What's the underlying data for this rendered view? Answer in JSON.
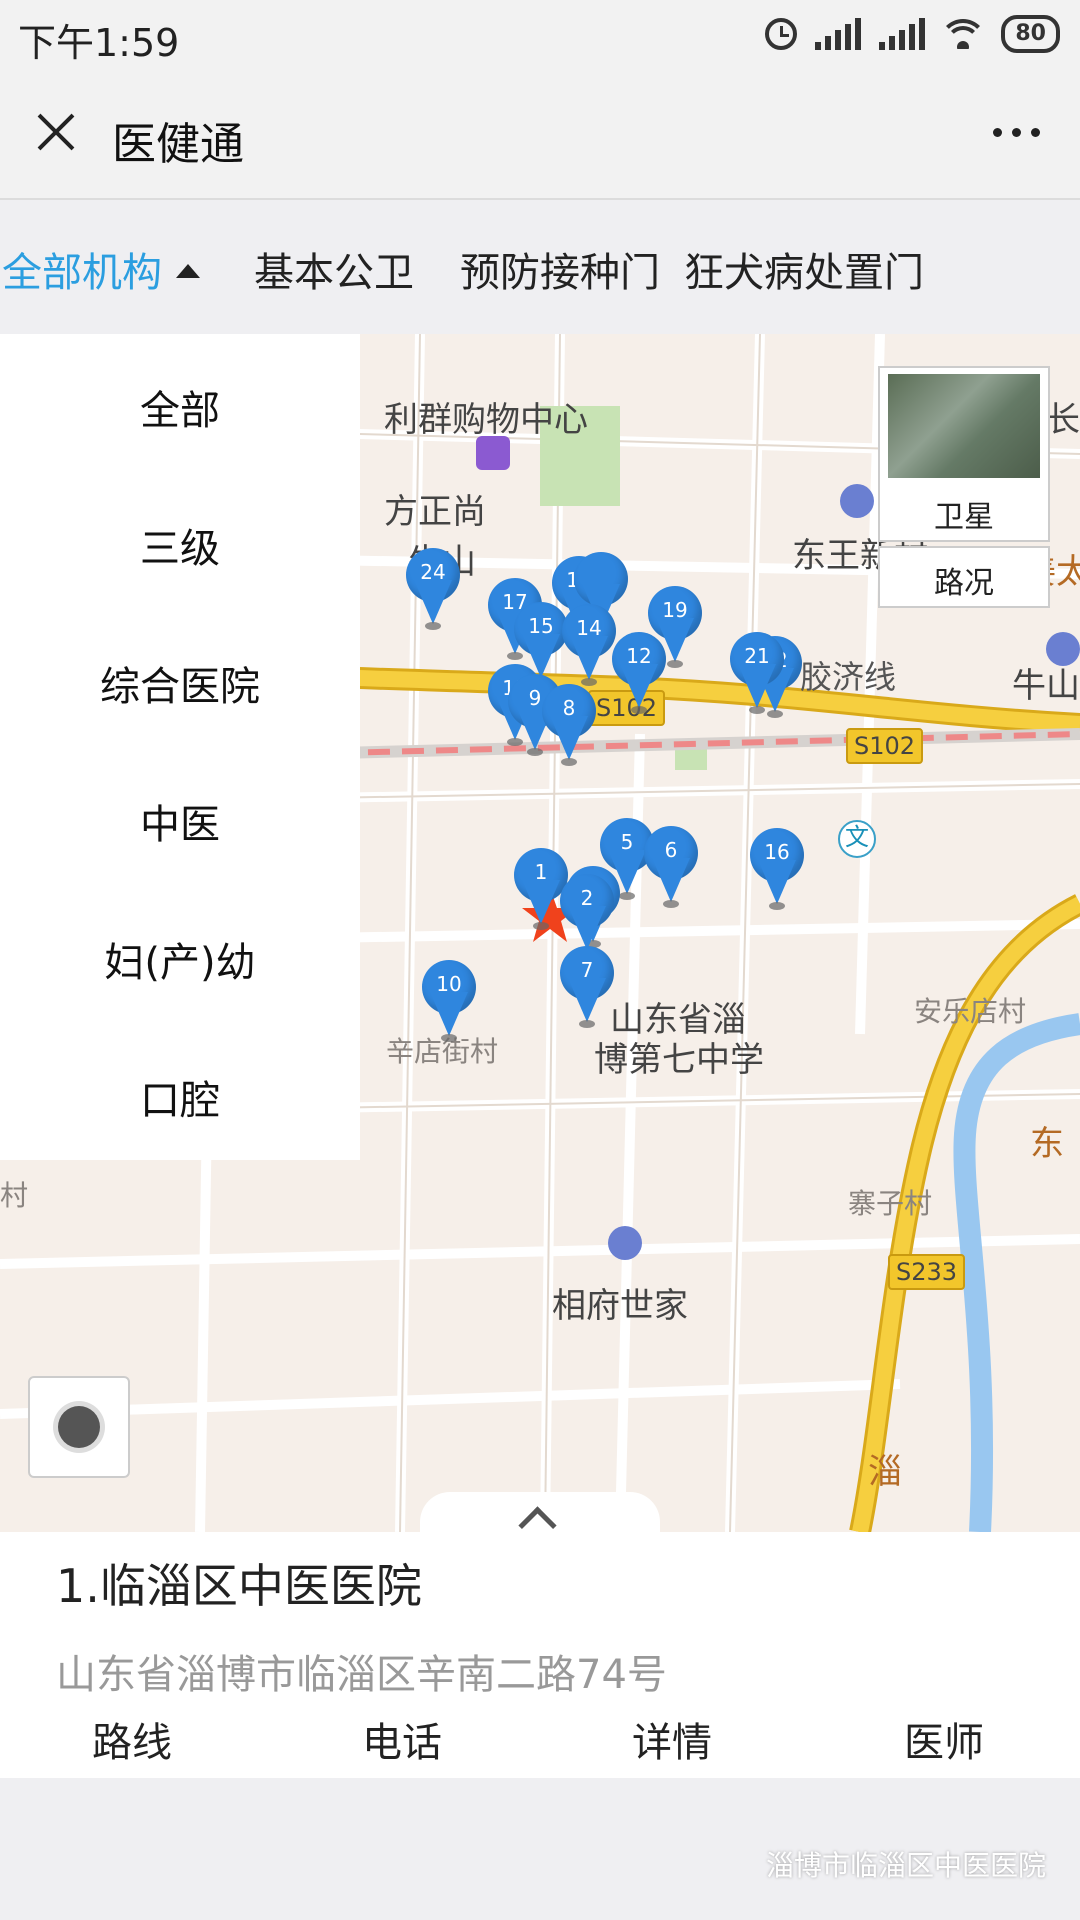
{
  "status": {
    "time": "下午1:59",
    "battery": "80"
  },
  "header": {
    "title": "医健通"
  },
  "tabs": [
    {
      "label": "全部机构",
      "active": true
    },
    {
      "label": "基本公卫"
    },
    {
      "label": "预防接种门"
    },
    {
      "label": "狂犬病处置门"
    }
  ],
  "dropdown": {
    "items": [
      "全部",
      "三级",
      "综合医院",
      "中医",
      "妇(产)幼",
      "口腔"
    ]
  },
  "map": {
    "controls": {
      "satellite": "卫星",
      "traffic": "路况"
    },
    "labels": {
      "liqun": "利群购物中心",
      "fangzheng": "方正尚",
      "niushan": "牛山",
      "dongwang": "东王新村",
      "jiangtai": "姜太",
      "changjia": "长家",
      "jiaoji": "胶济线",
      "niushan2": "牛山",
      "school": "山东省淄\n博第七中学",
      "school_line1": "山东省淄",
      "school_line2": "博第七中学",
      "anle": "安乐店村",
      "xindian": "辛店街村",
      "zhaizi": "寨子村",
      "xiangfu": "相府世家",
      "left_edge": "村",
      "dong": "东",
      "zi": "淄"
    },
    "roads": [
      "S102",
      "S102",
      "S233"
    ],
    "markers": [
      "1",
      "2",
      "5",
      "6",
      "7",
      "8",
      "9",
      "10",
      "11",
      "12",
      "14",
      "15",
      "16",
      "17",
      "18",
      "19",
      "21",
      "22",
      "24"
    ]
  },
  "selected": {
    "name": "1.临淄区中医医院",
    "address": "山东省淄博市临淄区辛南二路74号"
  },
  "actions": [
    "路线",
    "电话",
    "详情",
    "医师"
  ],
  "footer": {
    "watermark": "淄博市临淄区中医医院"
  },
  "colors": {
    "accent": "#2b9ee0",
    "marker": "#2f86de",
    "road_major": "#f2c62b"
  }
}
